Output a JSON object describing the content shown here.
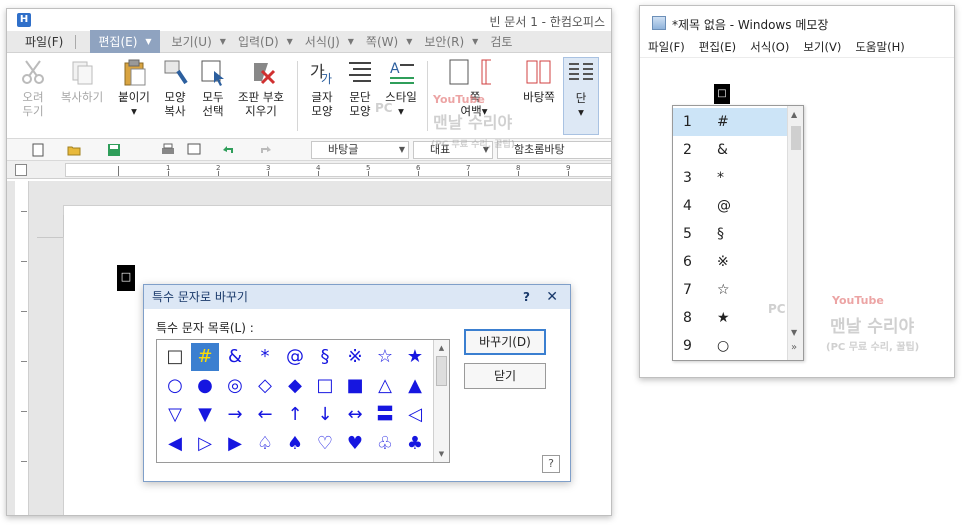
{
  "hwp": {
    "title": "빈 문서 1 - 한컴오피스",
    "menus": [
      "파일(F)",
      "편집(E)",
      "보기(U)",
      "입력(D)",
      "서식(J)",
      "쪽(W)",
      "보안(R)",
      "검토"
    ],
    "ribbon": [
      {
        "label1": "오려",
        "label2": "두기",
        "disabled": true
      },
      {
        "label1": "복사하기",
        "label2": "",
        "disabled": true
      },
      {
        "label1": "붙이기",
        "label2": "▾",
        "disabled": false
      },
      {
        "label1": "모양",
        "label2": "복사",
        "disabled": false
      },
      {
        "label1": "모두",
        "label2": "선택",
        "disabled": false
      },
      {
        "label1": "조판 부호",
        "label2": "지우기",
        "disabled": false
      },
      {
        "label1": "글자",
        "label2": "모양",
        "disabled": false
      },
      {
        "label1": "문단",
        "label2": "모양",
        "disabled": false
      },
      {
        "label1": "스타일",
        "label2": "▾",
        "disabled": false
      },
      {
        "label1": "쪽",
        "label2": "여백▾",
        "disabled": false
      },
      {
        "label1": "바탕쪽",
        "label2": "",
        "disabled": false
      },
      {
        "label1": "단",
        "label2": "▾",
        "disabled": false
      }
    ],
    "toolbar": {
      "style": "바탕글",
      "font_script": "대표",
      "font": "함초롬바탕"
    },
    "ruler_numbers": [
      "1",
      "2",
      "3",
      "4",
      "5",
      "6",
      "7",
      "8",
      "9"
    ],
    "cursor_symbol": "□",
    "dialog": {
      "title": "특수 문자로 바꾸기",
      "help_q": "?",
      "close": "✕",
      "list_label": "특수 문자 목록(L) :",
      "replace_button": "바꾸기(D)",
      "close_button": "닫기",
      "help_button": "?",
      "symbols": [
        [
          "□",
          "#",
          "&",
          "*",
          "@",
          "§",
          "※",
          "☆",
          "★"
        ],
        [
          "○",
          "●",
          "◎",
          "◇",
          "◆",
          "□",
          "■",
          "△",
          "▲"
        ],
        [
          "▽",
          "▼",
          "→",
          "←",
          "↑",
          "↓",
          "↔",
          "〓",
          "◁"
        ],
        [
          "◀",
          "▷",
          "▶",
          "♤",
          "♠",
          "♡",
          "♥",
          "♧",
          "♣"
        ]
      ],
      "selected": "#"
    }
  },
  "notepad": {
    "title": "*제목 없음 - Windows 메모장",
    "menus": [
      "파일(F)",
      "편집(E)",
      "서식(O)",
      "보기(V)",
      "도움말(H)"
    ],
    "cursor_symbol": "□",
    "candidates": [
      {
        "num": "1",
        "sym": "#"
      },
      {
        "num": "2",
        "sym": "&"
      },
      {
        "num": "3",
        "sym": "*"
      },
      {
        "num": "4",
        "sym": "@"
      },
      {
        "num": "5",
        "sym": "§"
      },
      {
        "num": "6",
        "sym": "※"
      },
      {
        "num": "7",
        "sym": "☆"
      },
      {
        "num": "8",
        "sym": "★"
      },
      {
        "num": "9",
        "sym": "○"
      }
    ],
    "more": "»"
  },
  "watermark": {
    "badge": "PC",
    "youtube": "YouTube",
    "brand": "맨날 수리야",
    "sub": "(PC 무료 수리, 꿀팁)"
  }
}
